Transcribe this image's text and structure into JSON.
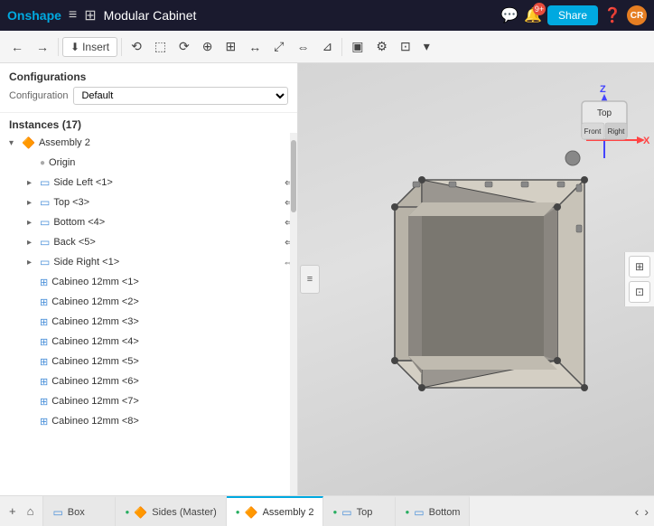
{
  "header": {
    "logo": "Onshape",
    "menu_icon": "≡",
    "settings_icon": "⊞",
    "title": "Modular Cabinet",
    "chat_icon": "💬",
    "notifications_count": "9+",
    "share_label": "Share",
    "help_label": "?",
    "avatar_initials": "CR"
  },
  "toolbar": {
    "back_icon": "←",
    "forward_icon": "→",
    "insert_label": "Insert",
    "buttons": [
      "⟲",
      "⬚",
      "⟳",
      "⊕",
      "⊞",
      "↔",
      "⤢",
      "⇔",
      "⊿",
      "▣",
      "⚙",
      "⊡",
      "▾"
    ]
  },
  "left_panel": {
    "config_title": "Configurations",
    "config_label": "Configuration",
    "config_value": "Default",
    "instances_title": "Instances (17)",
    "tree": [
      {
        "id": "assembly2",
        "level": 0,
        "chevron": true,
        "icon": "assembly",
        "label": "Assembly 2",
        "action": null
      },
      {
        "id": "origin",
        "level": 1,
        "chevron": false,
        "icon": "origin",
        "label": "Origin",
        "action": null
      },
      {
        "id": "side-left",
        "level": 1,
        "chevron": true,
        "icon": "part",
        "label": "Side Left <1>",
        "action": "⇐"
      },
      {
        "id": "top",
        "level": 1,
        "chevron": true,
        "icon": "part",
        "label": "Top <3>",
        "action": "⇐"
      },
      {
        "id": "bottom",
        "level": 1,
        "chevron": true,
        "icon": "part",
        "label": "Bottom <4>",
        "action": "⇐"
      },
      {
        "id": "back",
        "level": 1,
        "chevron": true,
        "icon": "part",
        "label": "Back <5>",
        "action": "⇐"
      },
      {
        "id": "side-right",
        "level": 1,
        "chevron": true,
        "icon": "part",
        "label": "Side Right <1>",
        "action": "⇔"
      },
      {
        "id": "cabineo1",
        "level": 1,
        "chevron": false,
        "icon": "part",
        "label": "Cabineo 12mm <1>",
        "action": null
      },
      {
        "id": "cabineo2",
        "level": 1,
        "chevron": false,
        "icon": "part",
        "label": "Cabineo 12mm <2>",
        "action": null
      },
      {
        "id": "cabineo3",
        "level": 1,
        "chevron": false,
        "icon": "part",
        "label": "Cabineo 12mm <3>",
        "action": null
      },
      {
        "id": "cabineo4",
        "level": 1,
        "chevron": false,
        "icon": "part",
        "label": "Cabineo 12mm <4>",
        "action": null
      },
      {
        "id": "cabineo5",
        "level": 1,
        "chevron": false,
        "icon": "part",
        "label": "Cabineo 12mm <5>",
        "action": null
      },
      {
        "id": "cabineo6",
        "level": 1,
        "chevron": false,
        "icon": "part",
        "label": "Cabineo 12mm <6>",
        "action": null
      },
      {
        "id": "cabineo7",
        "level": 1,
        "chevron": false,
        "icon": "part",
        "label": "Cabineo 12mm <7>",
        "action": null
      },
      {
        "id": "cabineo8",
        "level": 1,
        "chevron": false,
        "icon": "part",
        "label": "Cabineo 12mm <8>",
        "action": null
      }
    ]
  },
  "viewport": {
    "nav_cube": {
      "top_label": "Top",
      "front_label": "Front",
      "right_label": "Right",
      "z_label": "Z",
      "x_label": "X"
    },
    "right_icons": [
      "⊞",
      "⊡"
    ]
  },
  "bottom_tabs": {
    "add_icon": "+",
    "home_icon": "⌂",
    "tabs": [
      {
        "id": "box",
        "icon": "part",
        "label": "Box",
        "active": false,
        "closeable": false
      },
      {
        "id": "sides-master",
        "icon": "assembly",
        "label": "Sides (Master)",
        "active": false,
        "closeable": false,
        "status": true
      },
      {
        "id": "assembly2",
        "icon": "assembly",
        "label": "Assembly 2",
        "active": true,
        "closeable": false,
        "status": true
      },
      {
        "id": "top-tab",
        "icon": "part",
        "label": "Top",
        "active": false,
        "closeable": false,
        "status": true
      },
      {
        "id": "bottom-tab",
        "icon": "part",
        "label": "Bottom",
        "active": false,
        "closeable": false,
        "status": true
      }
    ],
    "nav_prev": "‹",
    "nav_next": "›"
  }
}
